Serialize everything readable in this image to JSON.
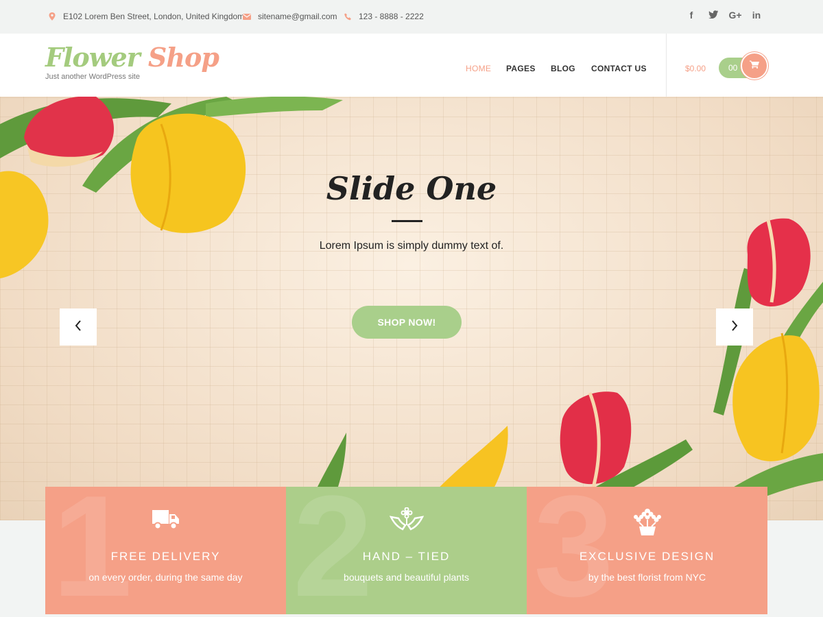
{
  "topbar": {
    "address": "E102 Lorem Ben Street, London, United Kingdom",
    "email": "sitename@gmail.com",
    "phone": "123 - 8888 - 2222",
    "icons": [
      "map-pin-icon",
      "envelope-icon",
      "phone-icon"
    ],
    "social": [
      {
        "name": "facebook-icon",
        "glyph": "f"
      },
      {
        "name": "twitter-icon",
        "glyph": "t"
      },
      {
        "name": "google-plus-icon",
        "glyph": "G+"
      },
      {
        "name": "linkedin-icon",
        "glyph": "in"
      }
    ]
  },
  "header": {
    "logo_word1": "Flower",
    "logo_word2": "Shop",
    "tagline": "Just another WordPress site",
    "nav": [
      "HOME",
      "PAGES",
      "BLOG",
      "CONTACT US"
    ],
    "active_nav": "HOME",
    "cart_total": "$0.00",
    "cart_count": "00",
    "cart_icon": "shopping-cart-icon"
  },
  "hero": {
    "title": "Slide One",
    "text": "Lorem Ipsum is simply dummy text of.",
    "button": "SHOP NOW!",
    "prev_icon": "chevron-left-icon",
    "next_icon": "chevron-right-icon"
  },
  "features": [
    {
      "number": "1",
      "title": "FREE DELIVERY",
      "subtitle": "on every order, during the same day",
      "icon": "truck-icon",
      "color": "#f5a087"
    },
    {
      "number": "2",
      "title": "HAND – TIED",
      "subtitle": "bouquets and beautiful plants",
      "icon": "hands-flower-icon",
      "color": "#acce8a"
    },
    {
      "number": "3",
      "title": "EXCLUSIVE DESIGN",
      "subtitle": "by the best florist from NYC",
      "icon": "flower-pot-icon",
      "color": "#f5a087"
    }
  ],
  "colors": {
    "accent": "#f5a087",
    "green": "#a9cf8b",
    "dark": "#222222"
  }
}
